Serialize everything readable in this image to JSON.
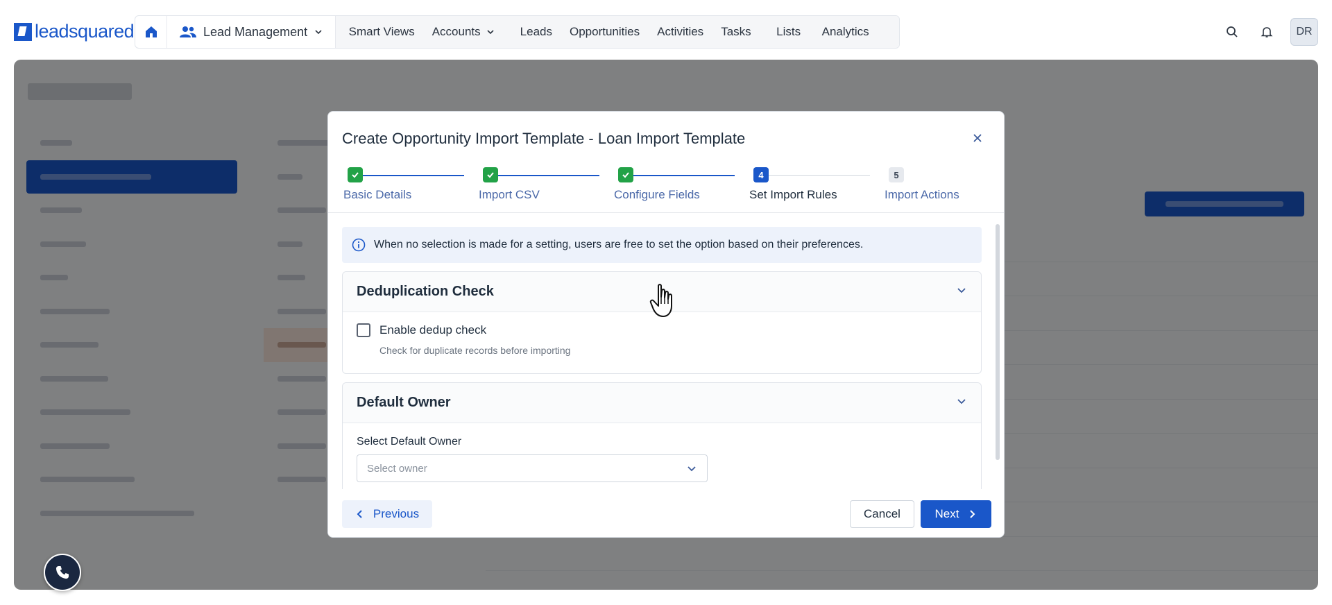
{
  "brand": {
    "logo_text": "leadsquared",
    "accent": "#1a57c9"
  },
  "topnav": {
    "module": "Lead Management",
    "items": [
      "Smart Views",
      "Accounts",
      "Leads",
      "Opportunities",
      "Activities",
      "Tasks",
      "Lists",
      "Analytics"
    ],
    "avatar_initials": "DR"
  },
  "modal": {
    "title": "Create Opportunity Import Template - Loan Import Template",
    "steps": [
      {
        "number": "1",
        "label": "Basic Details",
        "state": "done"
      },
      {
        "number": "2",
        "label": "Import CSV",
        "state": "done"
      },
      {
        "number": "3",
        "label": "Configure Fields",
        "state": "done"
      },
      {
        "number": "4",
        "label": "Set Import Rules",
        "state": "current"
      },
      {
        "number": "5",
        "label": "Import Actions",
        "state": "pending"
      }
    ],
    "info_text": "When no selection is made for a setting, users are free to set the option based on their preferences.",
    "dedup": {
      "title": "Deduplication Check",
      "checkbox_label": "Enable dedup check",
      "checkbox_checked": false,
      "help_text": "Check for duplicate records before importing"
    },
    "owner": {
      "title": "Default Owner",
      "field_label": "Select Default Owner",
      "placeholder": "Select owner"
    },
    "footer": {
      "previous": "Previous",
      "cancel": "Cancel",
      "next": "Next"
    }
  }
}
